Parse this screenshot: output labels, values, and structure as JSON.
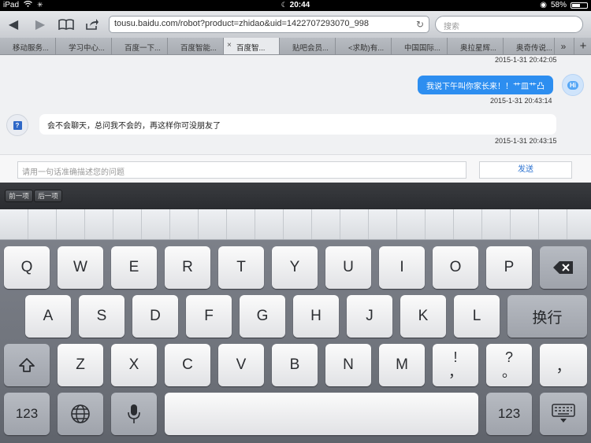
{
  "status": {
    "device": "iPad",
    "time": "20:44",
    "battery": "58%",
    "battery_level": 0.58
  },
  "toolbar": {
    "url": "tousu.baidu.com/robot?product=zhidao&uid=1422707293070_998",
    "search_placeholder": "搜索",
    "back_icon": "◀",
    "forward_icon": "▶",
    "bookmarks_icon": "📖",
    "share_icon": "⤴",
    "reload_icon": "↻"
  },
  "tabs": [
    {
      "label": "移动服务..."
    },
    {
      "label": "学习中心..."
    },
    {
      "label": "百度一下..."
    },
    {
      "label": "百度智能..."
    },
    {
      "label": "百度智..."
    },
    {
      "label": "贴吧会员..."
    },
    {
      "label": "<求助)有..."
    },
    {
      "label": "中国国际..."
    },
    {
      "label": "奥拉星辉..."
    },
    {
      "label": "奥奇传说..."
    }
  ],
  "tabs_more": "»",
  "tabs_add": "+",
  "tab_close": "×",
  "chat": {
    "ts_top": "2015-1-31 20:42:05",
    "user_msg": "我说下午叫你家长来！！艹皿艹凸",
    "user_ts": "2015-1-31 20:43:14",
    "user_avatar": "Hi",
    "bot_msg": "会不会聊天，总问我不会的，再这样你可没朋友了",
    "bot_ts": "2015-1-31 20:43:15",
    "bot_avatar": "?",
    "input_placeholder": "请用一句话准确描述您的问题",
    "send_label": "发送"
  },
  "formbar": {
    "prev": "前一项",
    "next": "后一项"
  },
  "keyboard": {
    "row1": [
      "Q",
      "W",
      "E",
      "R",
      "T",
      "Y",
      "U",
      "I",
      "O",
      "P"
    ],
    "row2": [
      "A",
      "S",
      "D",
      "F",
      "G",
      "H",
      "J",
      "K",
      "L"
    ],
    "row3": [
      "Z",
      "X",
      "C",
      "V",
      "B",
      "N",
      "M"
    ],
    "exclaim_top": "!",
    "exclaim_bottom": "，",
    "question_top": "?",
    "question_bottom": "。",
    "comma": "，",
    "return": "换行",
    "numbers": "123",
    "numbers_right": "123",
    "backspace_icon": "⌫",
    "shift_icon": "⇧",
    "globe_icon": "🌐",
    "mic_icon": "🎤",
    "dismiss_icon": "⌨"
  }
}
